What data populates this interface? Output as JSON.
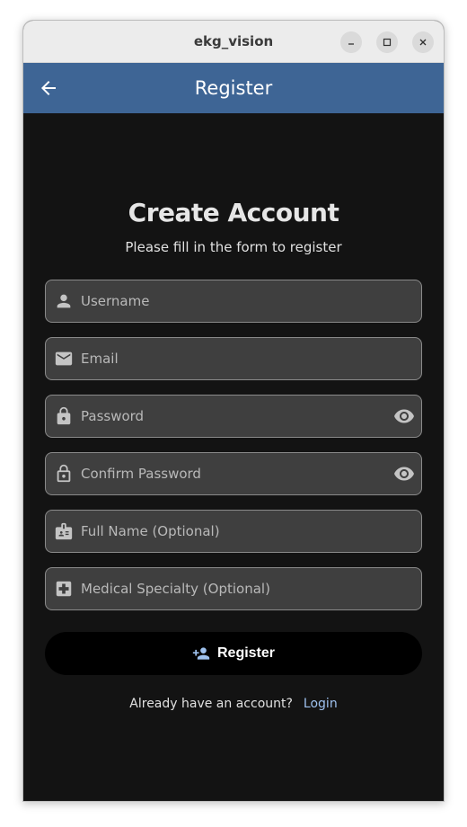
{
  "window": {
    "title": "ekg_vision"
  },
  "appbar": {
    "title": "Register"
  },
  "form": {
    "heading": "Create Account",
    "subheading": "Please fill in the form to register",
    "fields": [
      {
        "name": "username",
        "placeholder": "Username",
        "icon": "person-icon",
        "value": ""
      },
      {
        "name": "email",
        "placeholder": "Email",
        "icon": "mail-icon",
        "value": ""
      },
      {
        "name": "password",
        "placeholder": "Password",
        "icon": "lock-icon",
        "value": "",
        "toggle": "eye-icon"
      },
      {
        "name": "confirm_password",
        "placeholder": "Confirm Password",
        "icon": "lock-outline-icon",
        "value": "",
        "toggle": "eye-icon"
      },
      {
        "name": "full_name",
        "placeholder": "Full Name (Optional)",
        "icon": "badge-icon",
        "value": ""
      },
      {
        "name": "medical_specialty",
        "placeholder": "Medical Specialty (Optional)",
        "icon": "medical-cross-icon",
        "value": ""
      }
    ],
    "submit_label": "Register",
    "submit_icon": "person-add-icon"
  },
  "footer": {
    "prompt": "Already have an account?",
    "login_label": "Login"
  },
  "colors": {
    "appbar": "#3e6595",
    "background": "#131313",
    "field_bg": "#3f3f3f",
    "link": "#9ec1ee",
    "button": "#000000"
  }
}
